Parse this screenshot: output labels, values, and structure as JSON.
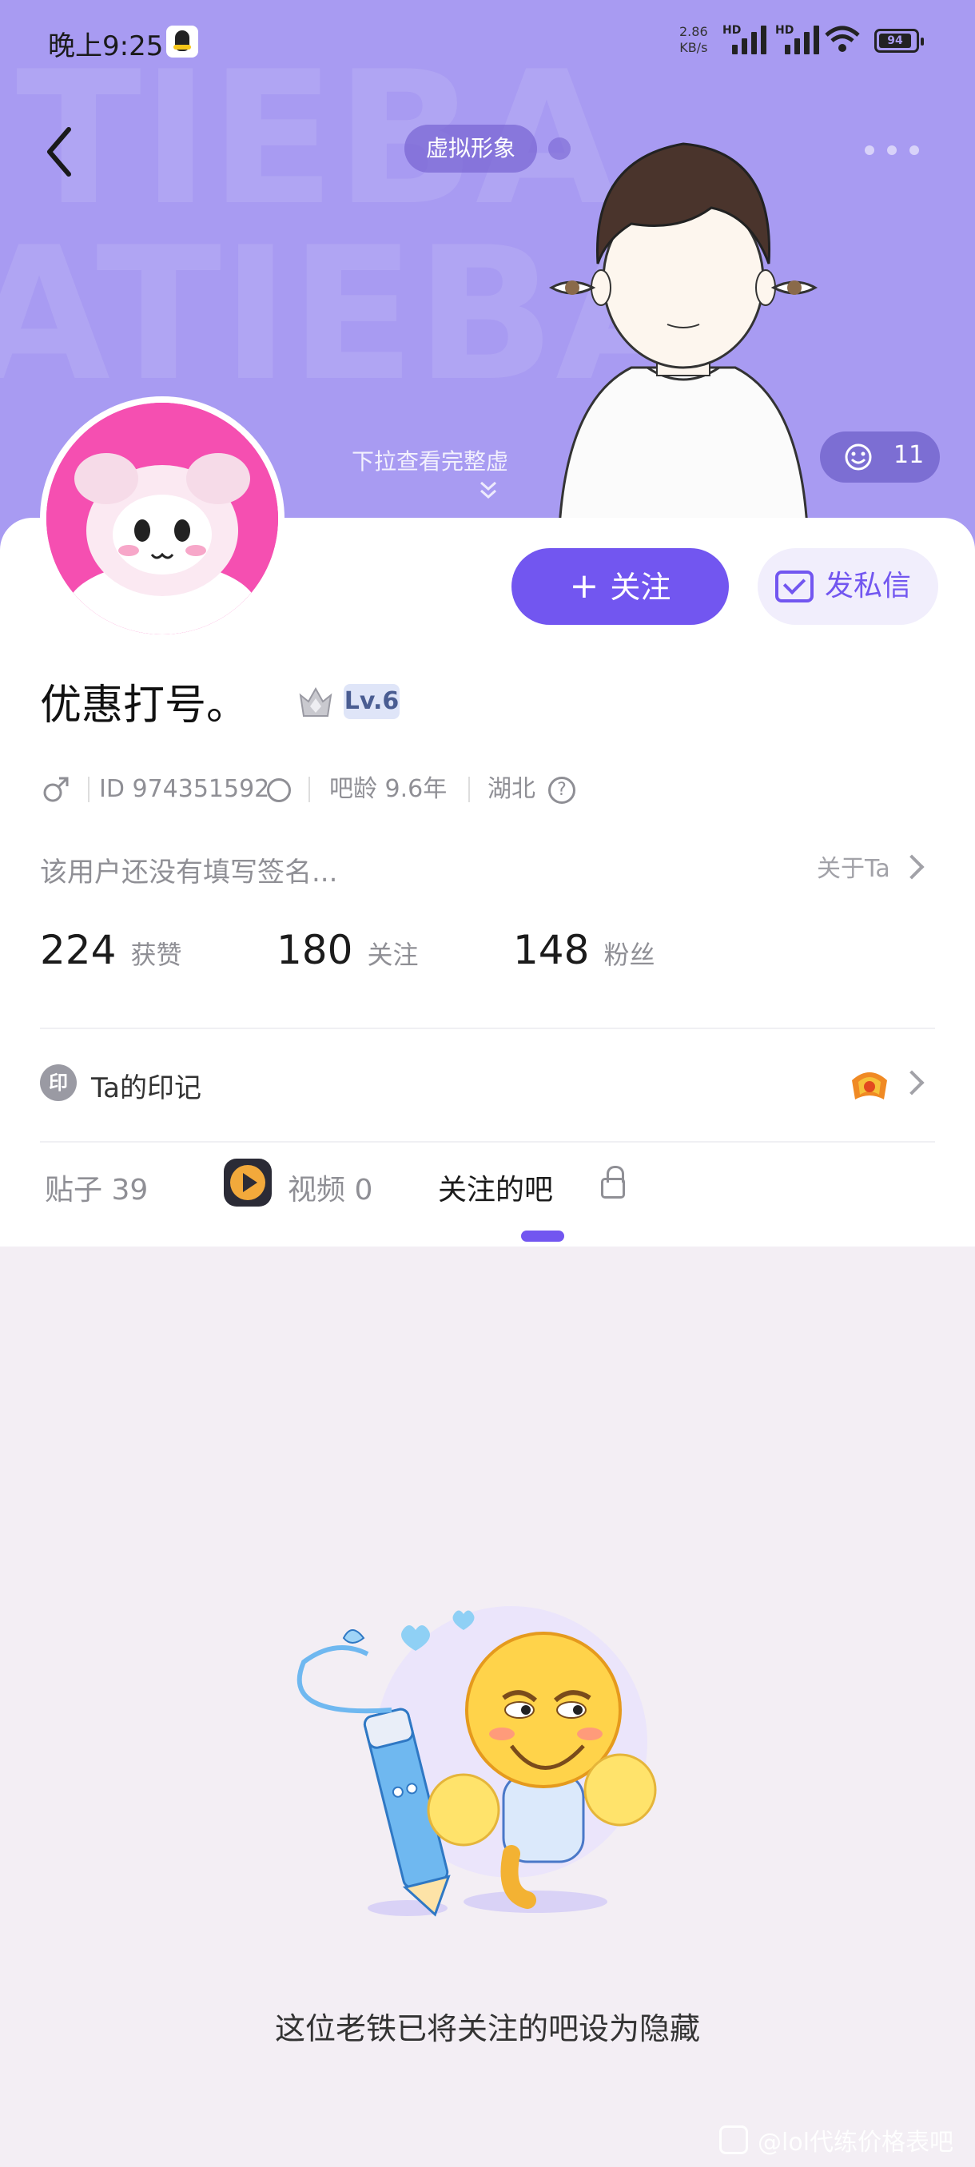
{
  "status_bar": {
    "time": "晚上9:25",
    "net_speed_value": "2.86",
    "net_speed_unit": "KB/s",
    "signal1_label": "HD",
    "signal2_label": "HD",
    "battery": "94"
  },
  "header": {
    "avatar_tag": "虚拟形象",
    "pull_hint": "下拉查看完整虚",
    "like_count": "11"
  },
  "actions": {
    "follow_label": "关注",
    "message_label": "发私信"
  },
  "profile": {
    "username": "优惠打号。",
    "level": "Lv.6",
    "id": "ID 974351592",
    "bar_age": "吧龄 9.6年",
    "location": "湖北",
    "signature": "该用户还没有填写签名...",
    "about_label": "关于Ta"
  },
  "stats": [
    {
      "value": "224",
      "label": "获赞"
    },
    {
      "value": "180",
      "label": "关注"
    },
    {
      "value": "148",
      "label": "粉丝"
    }
  ],
  "mark": {
    "icon_text": "印",
    "label": "Ta的印记"
  },
  "tabs": [
    {
      "label": "贴子 39"
    },
    {
      "label": "视频 0"
    },
    {
      "label": "关注的吧"
    }
  ],
  "empty_message": "这位老铁已将关注的吧设为隐藏",
  "watermark": "@lol代练价格表吧",
  "colors": {
    "header_bg": "#a89bf2",
    "accent": "#7256f0",
    "avatar_bg": "#f54fb1"
  }
}
